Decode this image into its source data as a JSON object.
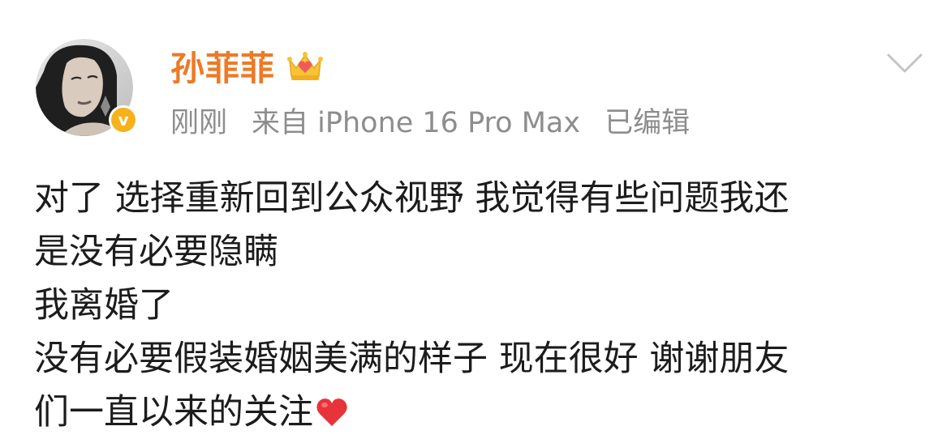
{
  "post": {
    "username": "孙菲菲",
    "verified_mark": "v",
    "meta": {
      "time": "刚刚",
      "source": "来自 iPhone 16 Pro Max",
      "edited": "已编辑"
    },
    "content_lines": [
      "对了 选择重新回到公众视野 我觉得有些问题我还",
      "是没有必要隐瞒",
      "我离婚了",
      "没有必要假装婚姻美满的样子 现在很好 谢谢朋友",
      "们一直以来的关注"
    ],
    "icons": {
      "crown": "crown-badge-icon",
      "chevron": "chevron-down-icon",
      "heart": "red-heart-emoji"
    },
    "colors": {
      "username": "#ec7a28",
      "meta": "#8d8d8d",
      "text": "#1c1c1c",
      "verify_badge": "#f6b21b",
      "heart": "#e8333a"
    }
  }
}
